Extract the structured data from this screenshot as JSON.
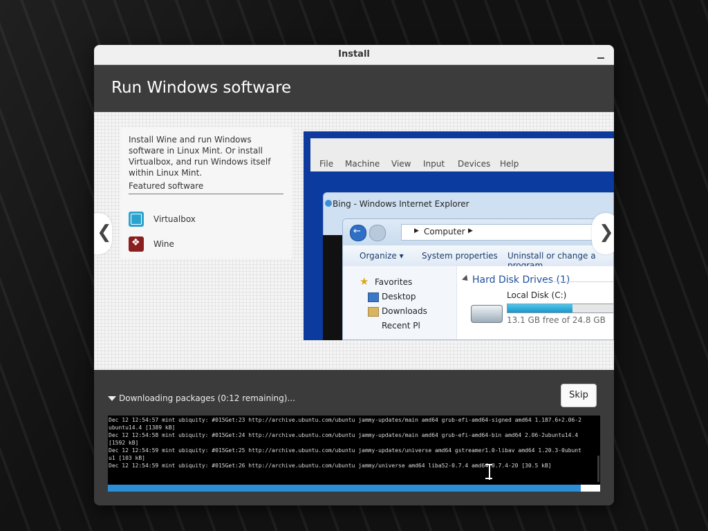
{
  "window": {
    "title": "Install"
  },
  "header": {
    "title": "Run Windows software"
  },
  "slide": {
    "description": "Install Wine and run Windows software in Linux Mint. Or install Virtualbox, and run Windows itself within Linux Mint.",
    "featured_label": "Featured software",
    "featured_items": [
      {
        "name": "Virtualbox",
        "icon": "virtualbox-icon"
      },
      {
        "name": "Wine",
        "icon": "wine-icon"
      }
    ],
    "prev_icon": "chevron-left-icon",
    "next_icon": "chevron-right-icon",
    "prev_glyph": "❮",
    "next_glyph": "❯",
    "screenshot": {
      "vbox_menu": [
        "File",
        "Machine",
        "View",
        "Input",
        "Devices",
        "Help"
      ],
      "ie_title": "Bing - Windows Internet Explorer",
      "breadcrumb": "Computer",
      "toolbar": [
        "Organize ▾",
        "System properties",
        "Uninstall or change a program"
      ],
      "sidebar": [
        "Favorites",
        "Desktop",
        "Downloads",
        "Recent Pl"
      ],
      "section_heading": "Hard Disk Drives (1)",
      "disk_name": "Local Disk (C:)",
      "disk_free": "13.1 GB free of 24.8 GB",
      "disk_used_fraction": 0.47
    }
  },
  "progress": {
    "status": "Downloading packages (0:12 remaining)...",
    "skip_label": "Skip",
    "fraction": 0.96,
    "accent_color": "#2b8ed6",
    "log": [
      "Dec 12 12:54:57 mint ubiquity: #015Get:23 http://archive.ubuntu.com/ubuntu jammy-updates/main amd64 grub-efi-amd64-signed amd64 1.187.6+2.06-2",
      "ubuntu14.4 [1389 kB]",
      "Dec 12 12:54:58 mint ubiquity: #015Get:24 http://archive.ubuntu.com/ubuntu jammy-updates/main amd64 grub-efi-amd64-bin amd64 2.06-2ubuntu14.4",
      "[1592 kB]",
      "Dec 12 12:54:59 mint ubiquity: #015Get:25 http://archive.ubuntu.com/ubuntu jammy-updates/universe amd64 gstreamer1.0-libav amd64 1.20.3-0ubunt",
      "u1 [103 kB]",
      "Dec 12 12:54:59 mint ubiquity: #015Get:26 http://archive.ubuntu.com/ubuntu jammy/universe amd64 liba52-0.7.4 amd64 0.7.4-20 [30.5 kB]"
    ]
  }
}
